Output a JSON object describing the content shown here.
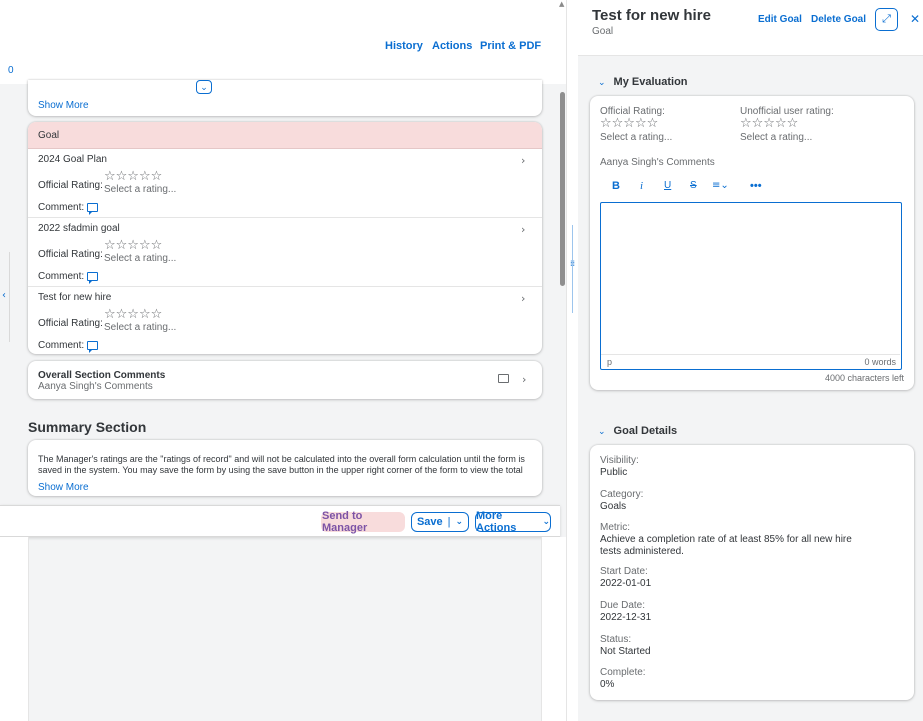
{
  "left": {
    "toolbar": {
      "history": "History",
      "actions": "Actions",
      "print_pdf": "Print & PDF"
    },
    "count_stub": "0",
    "top_card": {
      "show_more": "Show More"
    },
    "goal_section": {
      "header": "Goal",
      "items": [
        {
          "title": "2024 Goal Plan",
          "rating_label": "Official Rating:",
          "stars": "☆☆☆☆☆",
          "select": "Select a rating...",
          "comment_label": "Comment:"
        },
        {
          "title": "2022 sfadmin goal",
          "rating_label": "Official Rating:",
          "stars": "☆☆☆☆☆",
          "select": "Select a rating...",
          "comment_label": "Comment:"
        },
        {
          "title": "Test for new hire",
          "rating_label": "Official Rating:",
          "stars": "☆☆☆☆☆",
          "select": "Select a rating...",
          "comment_label": "Comment:"
        }
      ]
    },
    "overall": {
      "title": "Overall Section Comments",
      "subtitle": "Aanya Singh's Comments"
    },
    "summary": {
      "heading": "Summary Section",
      "text": "The Manager's ratings are the \"ratings of record\" and will not be calculated into the overall form calculation until the form is saved in the system. You may save the form by using the save button in the upper right corner of the form to view the total score, or save at",
      "show_more": "Show More"
    },
    "footer": {
      "send_to_manager": "Send to Manager",
      "save": "Save",
      "more_actions": "More Actions"
    }
  },
  "right": {
    "title": "Test for new hire",
    "subtitle": "Goal",
    "edit_goal": "Edit Goal",
    "delete_goal": "Delete Goal",
    "my_evaluation": {
      "heading": "My Evaluation",
      "official_label": "Official Rating:",
      "official_stars": "☆☆☆☆☆",
      "official_select": "Select a rating...",
      "unofficial_label": "Unofficial user rating:",
      "unofficial_stars": "☆☆☆☆☆",
      "unofficial_select": "Select a rating...",
      "comments_label": "Aanya Singh's Comments",
      "editor_path": "p",
      "word_count": "0 words",
      "chars_left": "4000 characters left"
    },
    "goal_details": {
      "heading": "Goal Details",
      "fields": [
        {
          "label": "Visibility:",
          "value": "Public"
        },
        {
          "label": "Category:",
          "value": "Goals"
        },
        {
          "label": "Metric:",
          "value": "Achieve a completion rate of at least 85% for all new hire tests administered."
        },
        {
          "label": "Start Date:",
          "value": "2022-01-01"
        },
        {
          "label": "Due Date:",
          "value": "2022-12-31"
        },
        {
          "label": "Status:",
          "value": "Not Started"
        },
        {
          "label": "Complete:",
          "value": "0%"
        }
      ]
    }
  },
  "colors": {
    "accent": "#0a6ed1",
    "goal_header_bg": "#f8dcdc",
    "send_bg": "#f8dcdc",
    "panel_bg": "#f3f4f5"
  }
}
